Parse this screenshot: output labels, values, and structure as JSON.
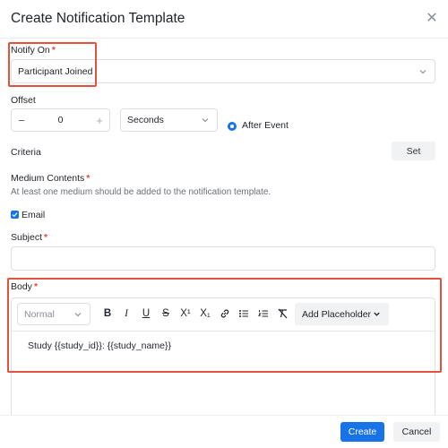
{
  "modal": {
    "title": "Create Notification Template"
  },
  "notify_on": {
    "label": "Notify On",
    "required_mark": "*",
    "value": "Participant Joined"
  },
  "offset": {
    "label": "Offset",
    "minus": "−",
    "value": "0",
    "plus": "+",
    "unit": "Seconds",
    "event_option": "After Event"
  },
  "criteria": {
    "label": "Criteria",
    "set_button": "Set"
  },
  "medium": {
    "label": "Medium Contents",
    "required_mark": "*",
    "hint": "At least one medium should be added to the notification template.",
    "email_label": "Email",
    "email_checked": true
  },
  "subject": {
    "label": "Subject",
    "required_mark": "*",
    "value": ""
  },
  "body": {
    "label": "Body",
    "required_mark": "*",
    "format": "Normal",
    "toolbar": [
      "B",
      "I",
      "U",
      "S",
      "X¹",
      "X₁"
    ],
    "add_placeholder": "Add Placeholder",
    "content": "Study {{study_id}}: {{study_name}}"
  },
  "footer": {
    "create": "Create",
    "cancel": "Cancel"
  },
  "colors": {
    "primary": "#1872e8",
    "highlight": "#e4513e",
    "required": "#e5483b"
  }
}
